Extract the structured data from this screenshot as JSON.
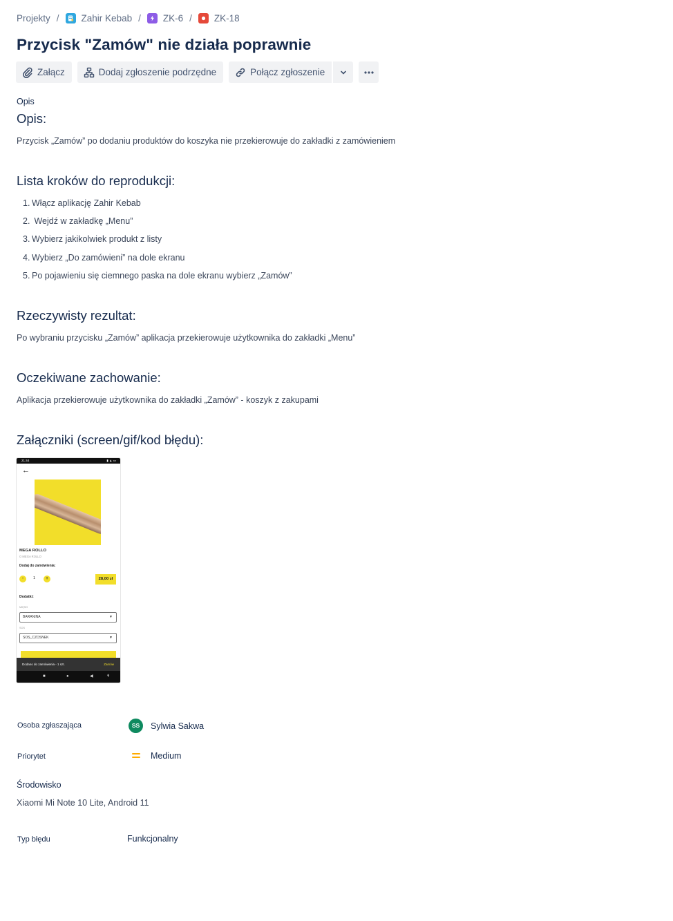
{
  "breadcrumb": {
    "root": "Projekty",
    "project": "Zahir Kebab",
    "epic": "ZK-6",
    "issue": "ZK-18",
    "separator": "/"
  },
  "issue": {
    "title": "Przycisk \"Zamów\" nie działa poprawnie"
  },
  "toolbar": {
    "attach_label": "Załącz",
    "add_child_label": "Dodaj zgłoszenie podrzędne",
    "link_label": "Połącz zgłoszenie"
  },
  "description": {
    "label": "Opis",
    "heading": "Opis:",
    "text": "Przycisk „Zamów” po dodaniu produktów do koszyka nie przekierowuje do zakładki z zamówieniem",
    "steps_heading": "Lista kroków do reprodukcji:",
    "steps": [
      {
        "num": "1.",
        "text": "Włącz aplikację Zahir Kebab"
      },
      {
        "num": "2.",
        "text": " Wejdź w zakładkę „Menu”"
      },
      {
        "num": "3.",
        "text": "Wybierz jakikolwiek produkt z listy"
      },
      {
        "num": "4.",
        "text": "Wybierz „Do zamówieni” na dole ekranu"
      },
      {
        "num": "5.",
        "text": "Po pojawieniu się ciemnego paska na dole ekranu wybierz „Zamów”"
      }
    ],
    "actual_heading": "Rzeczywisty rezultat:",
    "actual_text": "Po wybraniu przycisku „Zamów” aplikacja przekierowuje użytkownika do zakładki „Menu”",
    "expected_heading": "Oczekiwane zachowanie:",
    "expected_text": "Aplikacja przekierowuje użytkownika do zakładki „Zamów” - koszyk z zakupami",
    "attachments_heading": "Załączniki (screen/gif/kod błędu):"
  },
  "attachment_screenshot": {
    "status_time": "21:44",
    "product_name": "MEGA ROLLO",
    "product_sub": "O MEGA ROLLO",
    "add_label": "Dodaj do zamówienia:",
    "minus": "-",
    "plus": "+",
    "quantity": "1",
    "price": "28,00 zł",
    "addons_label": "Dodatki:",
    "meat_label": "MIĘSO",
    "meat_value": "BARANINA",
    "sauce_label": "SOS",
    "sauce_value": "SOS_CZOSNEK",
    "snackbar_text": "Dodano do zamówienia - 1 szt.",
    "snackbar_action": "Zamów"
  },
  "fields": {
    "reporter_label": "Osoba zgłaszająca",
    "reporter_initials": "SS",
    "reporter_name": "Sylwia Sakwa",
    "priority_label": "Priorytet",
    "priority_value": "Medium",
    "environment_label": "Środowisko",
    "environment_value": "Xiaomi Mi Note 10 Lite, Android 11",
    "bug_type_label": "Typ błędu",
    "bug_type_value": "Funkcjonalny"
  },
  "colors": {
    "text_primary": "#172b4d",
    "text_secondary": "#5e6c84",
    "button_bg": "#f1f2f4",
    "project_icon": "#2fa7df",
    "epic_icon": "#8d5ce6",
    "bug_icon": "#e5493a",
    "avatar": "#0e8a5f",
    "priority_medium": "#ffab00"
  }
}
